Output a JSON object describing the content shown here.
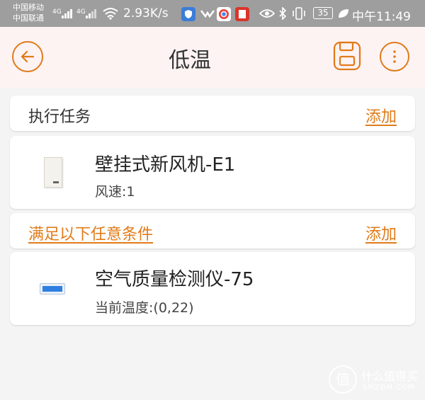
{
  "statusbar": {
    "carrier1": "中国移动",
    "carrier2": "中国联通",
    "net1": "4G",
    "net2": "4G",
    "speed": "2.93K/s",
    "battery": "35",
    "time": "中午11:49"
  },
  "header": {
    "title": "低温",
    "back_icon": "arrow-left-icon",
    "save_icon": "save-floppy-icon",
    "more_icon": "more-vertical-icon"
  },
  "tasks": {
    "label": "执行任务",
    "add_label": "添加",
    "device": {
      "name": "壁挂式新风机-E1",
      "detail": "风速:1"
    }
  },
  "conditions": {
    "label": "满足以下任意条件",
    "add_label": "添加",
    "device": {
      "name": "空气质量检测仪-75",
      "detail": "当前温度:(0,22)"
    }
  },
  "watermark": {
    "text": "什么值得买",
    "sub": "SMZDM.COM"
  },
  "colors": {
    "accent": "#e07b1a",
    "header_bg": "#fdf3f3",
    "statusbar_bg": "#9e9e9e"
  }
}
